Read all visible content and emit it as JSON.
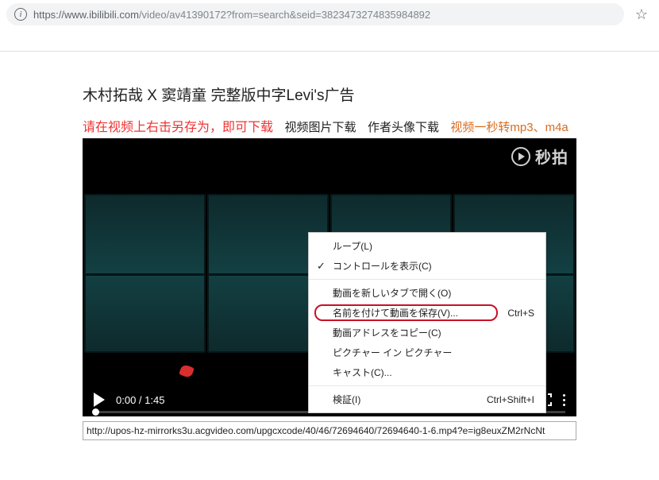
{
  "addr": {
    "url_host": "https://www.ibilibili.com",
    "url_rest": "/video/av41390172?from=search&seid=3823473274835984892"
  },
  "page": {
    "title": "木村拓哉 X 窦靖童 完整版中字Levi's广告",
    "hint_red": "请在视频上右击另存为，即可下载",
    "link_img": "视频图片下载",
    "link_avatar": "作者头像下载",
    "link_convert": "视频一秒转mp3、m4a"
  },
  "watermark": "秒拍",
  "player": {
    "time_current": "0:00",
    "time_total": "1:45"
  },
  "ctx": {
    "loop": "ループ(L)",
    "show_controls": "コントロールを表示(C)",
    "open_new_tab": "動画を新しいタブで開く(O)",
    "save_as": "名前を付けて動画を保存(V)...",
    "save_as_shortcut": "Ctrl+S",
    "copy_addr": "動画アドレスをコピー(C)",
    "pip": "ピクチャー イン ピクチャー",
    "cast": "キャスト(C)...",
    "inspect": "検証(I)",
    "inspect_shortcut": "Ctrl+Shift+I"
  },
  "video_url": "http://upos-hz-mirrorks3u.acgvideo.com/upgcxcode/40/46/72694640/72694640-1-6.mp4?e=ig8euxZM2rNcNt"
}
